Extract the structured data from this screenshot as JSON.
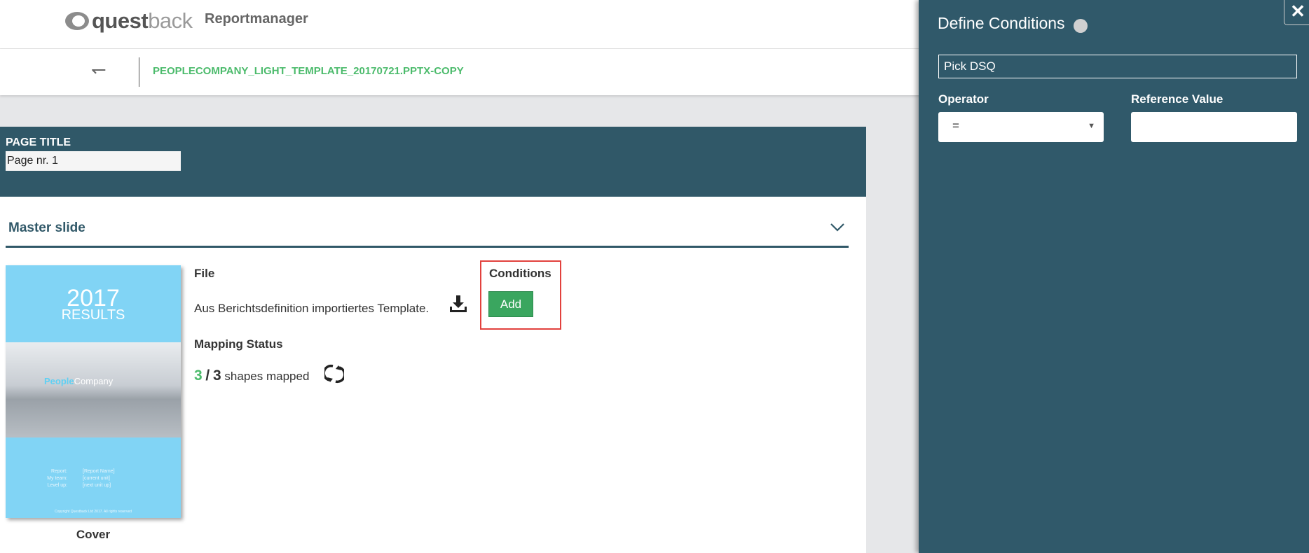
{
  "header": {
    "logo": "questback",
    "app_title": "Reportmanager"
  },
  "breadcrumb": {
    "back_icon": "back-arrow-icon",
    "filename": "PEOPLECOMPANY_LIGHT_TEMPLATE_20170721.PPTX-COPY"
  },
  "page": {
    "title_label": "PAGE TITLE",
    "title_value": "Page nr. 1"
  },
  "master": {
    "label": "Master slide",
    "chevron_icon": "chevron-down-icon"
  },
  "thumbnail": {
    "year": "2017",
    "results": "RESULTS",
    "brand_a": "People",
    "brand_b": "Company",
    "meta": [
      {
        "k": "Report:",
        "v": "[Report Name]"
      },
      {
        "k": "My team:",
        "v": "[current unit]"
      },
      {
        "k": "Level up:",
        "v": "[next unit up]"
      }
    ],
    "copyright": "Copyright Questback Ltd 2017. All rights reserved",
    "caption": "Cover"
  },
  "file": {
    "heading": "File",
    "text": "Aus Berichtsdefinition importiertes Template.",
    "download_icon": "download-icon"
  },
  "conditions": {
    "heading": "Conditions",
    "add_label": "Add"
  },
  "mapping": {
    "heading": "Mapping Status",
    "mapped": "3",
    "separator": "/",
    "total": "3",
    "suffix": "shapes mapped",
    "refresh_icon": "refresh-icon"
  },
  "panel": {
    "title": "Define Conditions",
    "close": "✕",
    "dsq_value": "Pick DSQ",
    "operator_label": "Operator",
    "operator_value": "=",
    "reference_label": "Reference Value",
    "reference_value": ""
  },
  "colors": {
    "accent_green": "#4cbb6c",
    "button_green": "#3aa65f",
    "dark_teal": "#305868",
    "highlight_red": "#e2413d",
    "thumb_blue": "#81d4f5"
  }
}
